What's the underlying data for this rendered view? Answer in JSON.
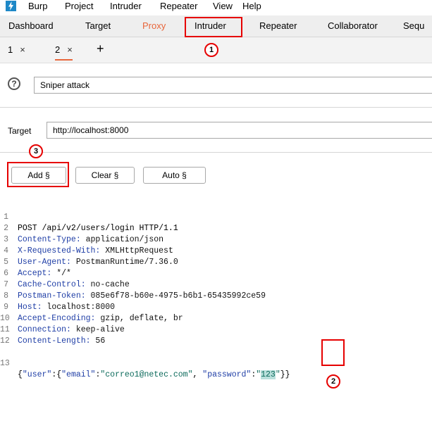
{
  "menu": {
    "items": [
      "Burp",
      "Project",
      "Intruder",
      "Repeater",
      "View",
      "Help"
    ]
  },
  "tabs": [
    "Dashboard",
    "Target",
    "Proxy",
    "Intruder",
    "Repeater",
    "Collaborator",
    "Sequ"
  ],
  "subtabs": [
    {
      "label": "1",
      "close": "×"
    },
    {
      "label": "2",
      "close": "×"
    }
  ],
  "new_tab": "+",
  "attack": {
    "help": "?",
    "type": "Sniper attack"
  },
  "target": {
    "label": "Target",
    "url": "http://localhost:8000"
  },
  "buttons": {
    "add": "Add §",
    "clear": "Clear §",
    "auto": "Auto §"
  },
  "request": {
    "line_numbers": [
      "1",
      "2",
      "3",
      "4",
      "5",
      "6",
      "7",
      "8",
      "9",
      "10",
      "11",
      "12",
      "13"
    ],
    "request_line": "POST /api/v2/users/login HTTP/1.1",
    "headers": [
      {
        "name": "Content-Type:",
        "value": " application/json"
      },
      {
        "name": "X-Requested-With:",
        "value": " XMLHttpRequest"
      },
      {
        "name": "User-Agent:",
        "value": " PostmanRuntime/7.36.0"
      },
      {
        "name": "Accept:",
        "value": " */*"
      },
      {
        "name": "Cache-Control:",
        "value": " no-cache"
      },
      {
        "name": "Postman-Token:",
        "value": " 085e6f78-b60e-4975-b6b1-65435992ce59"
      },
      {
        "name": "Host:",
        "value": " localhost:8000"
      },
      {
        "name": "Accept-Encoding:",
        "value": " gzip, deflate, br"
      },
      {
        "name": "Connection:",
        "value": " keep-alive"
      },
      {
        "name": "Content-Length:",
        "value": " 56"
      }
    ],
    "body": {
      "p1": "{",
      "k1": "\"user\"",
      "p2": ":{",
      "k2": "\"email\"",
      "p3": ":",
      "v1": "\"correo1@netec.com\"",
      "p4": ", ",
      "k3": "\"password\"",
      "p5": ":",
      "q1": "\"",
      "payload": "123",
      "q2": "\"",
      "p6": "}}"
    }
  },
  "annotations": {
    "a1": "1",
    "a2": "2",
    "a3": "3"
  },
  "colors": {
    "accent": "#e8663b",
    "annotation": "#e60000",
    "header_name": "#1f3ea6",
    "json_string": "#0d6b5c"
  }
}
